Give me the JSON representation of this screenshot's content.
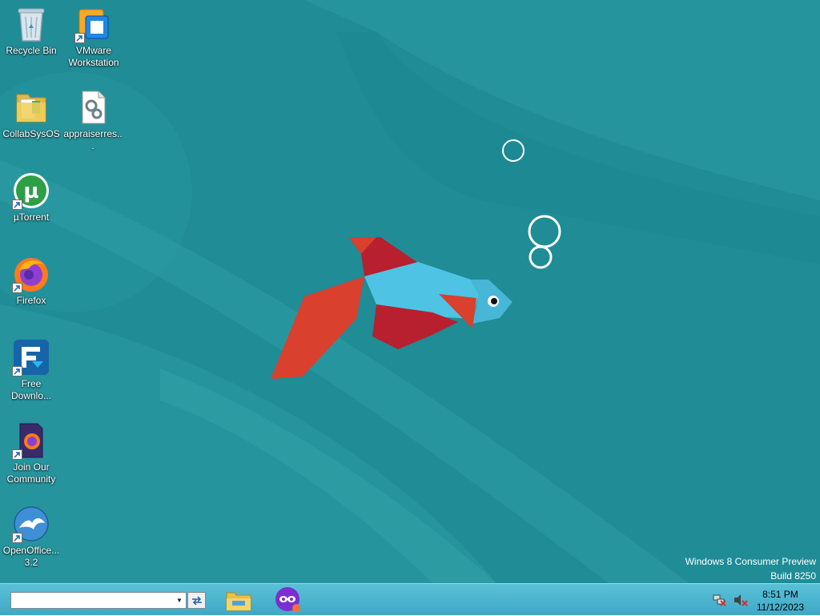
{
  "desktop": {
    "icons": [
      {
        "label": "Recycle Bin",
        "icon": "recycle-bin-icon"
      },
      {
        "label": "VMware Workstation",
        "icon": "vmware-icon"
      },
      {
        "label": "CollabSysOS",
        "icon": "folder-icon"
      },
      {
        "label": "appraiserres...",
        "icon": "settings-file-icon"
      },
      {
        "label": "µTorrent",
        "icon": "utorrent-icon"
      },
      {
        "label": "Firefox",
        "icon": "firefox-icon"
      },
      {
        "label": "Free Downlo...",
        "icon": "free-download-manager-icon"
      },
      {
        "label": "Join Our Community",
        "icon": "firefox-community-icon"
      },
      {
        "label": "OpenOffice... 3.2",
        "icon": "openoffice-icon"
      }
    ],
    "watermark": {
      "line1": "Windows 8 Consumer Preview",
      "line2": "Build 8250"
    },
    "wallpaper": {
      "background": "#1f8c96",
      "fish_body": "#4fc3e3",
      "fish_fins": "#b81f2f",
      "fish_tail": "#d9402e"
    }
  },
  "taskbar": {
    "address_value": "",
    "pinned": [
      "file-explorer-icon",
      "incognito-browser-icon"
    ],
    "tray_icons": [
      "network-icon",
      "volume-muted-icon"
    ],
    "time": "8:51 PM",
    "date": "11/12/2023",
    "background": "#4ab4cf"
  }
}
